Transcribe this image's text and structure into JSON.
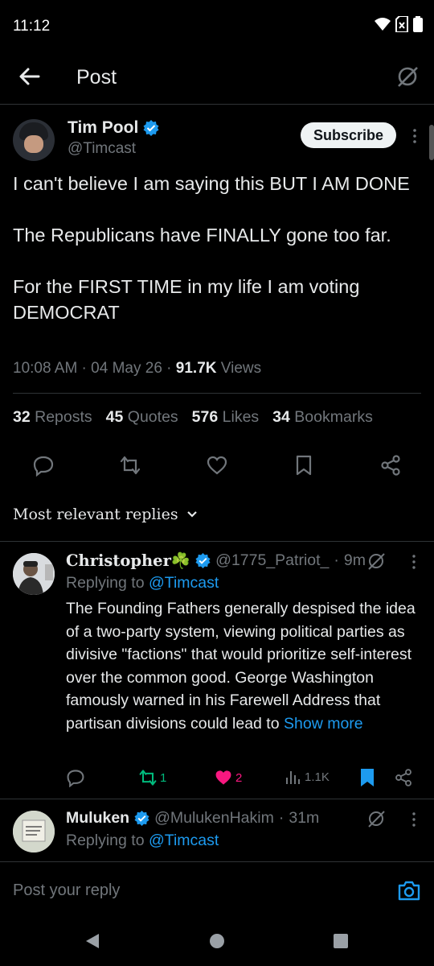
{
  "status": {
    "time": "11:12"
  },
  "header": {
    "title": "Post"
  },
  "post": {
    "author_name": "Tim Pool",
    "handle": "@Timcast",
    "subscribe_label": "Subscribe",
    "text": "I can't believe I am saying this BUT I AM DONE\n\nThe Republicans have FINALLY gone too far.\n\nFor the FIRST TIME in my life I am voting DEMOCRAT",
    "time": "10:08 AM",
    "date": "04 May 26",
    "views_count": "91.7K",
    "views_label": "Views",
    "stats": [
      {
        "count": "32",
        "label": "Reposts"
      },
      {
        "count": "45",
        "label": "Quotes"
      },
      {
        "count": "576",
        "label": "Likes"
      },
      {
        "count": "34",
        "label": "Bookmarks"
      }
    ]
  },
  "replies_sort": {
    "label": "Most relevant replies"
  },
  "replies": [
    {
      "name": "Christopher☘️",
      "handle": "@1775_Patriot_",
      "age": "9m",
      "replying_prefix": "Replying to",
      "replying_to": "@Timcast",
      "text": "The Founding Fathers generally despised the idea of a two-party system, viewing political parties as divisive \"factions\" that would prioritize self-interest over the common good. George Washington famously warned in his Farewell Address that partisan divisions could lead to",
      "show_more": "Show more",
      "reposts": "1",
      "likes": "2",
      "views": "1.1K"
    },
    {
      "name": "Muluken",
      "handle": "@MulukenHakim",
      "age": "31m",
      "replying_prefix": "Replying to",
      "replying_to": "@Timcast"
    }
  ],
  "compose": {
    "placeholder": "Post your reply"
  },
  "colors": {
    "accent": "#1d9bf0",
    "like": "#f91880",
    "repost": "#00ba7c",
    "muted": "#71767b"
  }
}
